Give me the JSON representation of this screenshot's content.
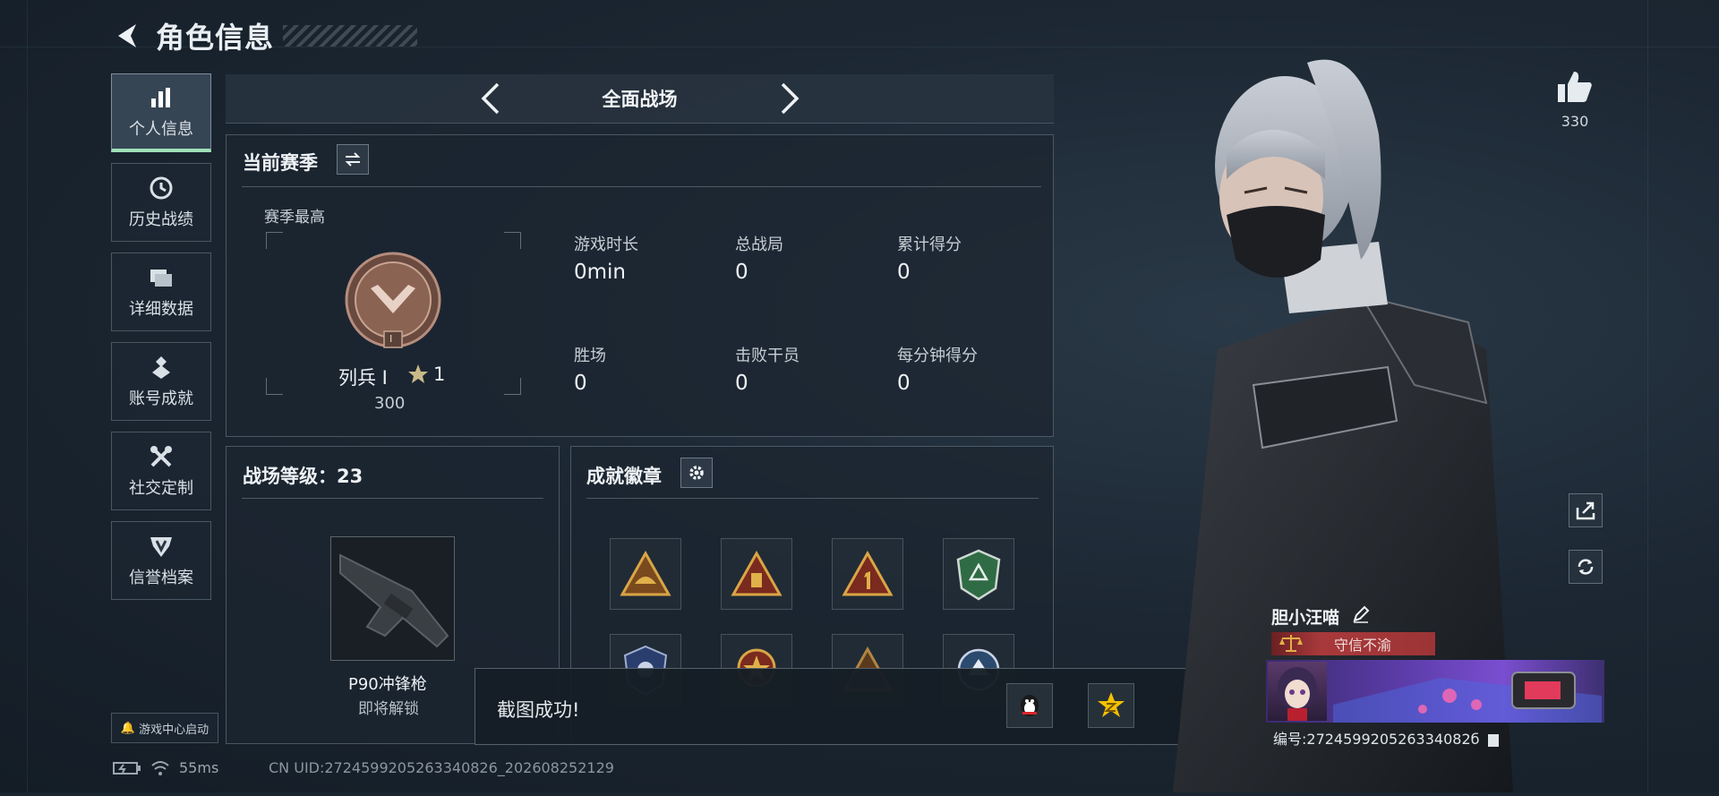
{
  "header": {
    "title": "角色信息"
  },
  "nav": {
    "items": [
      {
        "label": "个人信息"
      },
      {
        "label": "历史战绩"
      },
      {
        "label": "详细数据"
      },
      {
        "label": "账号成就"
      },
      {
        "label": "社交定制"
      },
      {
        "label": "信誉档案"
      }
    ],
    "launch_label": "游戏中心启动"
  },
  "mode": {
    "title": "全面战场"
  },
  "season": {
    "title": "当前赛季",
    "best_label": "赛季最高",
    "rank_name": "列兵 I",
    "stars": "1",
    "rank_score": "300",
    "rank_level": "I",
    "stats": [
      {
        "label": "游戏时长",
        "value": "0min"
      },
      {
        "label": "总战局",
        "value": "0"
      },
      {
        "label": "累计得分",
        "value": "0"
      },
      {
        "label": "胜场",
        "value": "0"
      },
      {
        "label": "击败干员",
        "value": "0"
      },
      {
        "label": "每分钟得分",
        "value": "0"
      }
    ]
  },
  "battlefield": {
    "level_title": "战场等级：23",
    "weapon_name": "P90冲锋枪",
    "weapon_status": "即将解锁"
  },
  "achievements": {
    "title": "成就徽章"
  },
  "toast": {
    "message": "截图成功!"
  },
  "right": {
    "likes": "330",
    "player_name": "胆小汪喵",
    "player_title": "守信不渝",
    "player_id": "编号:272459920526334082б"
  },
  "status_bar": {
    "ping": "55ms",
    "uid": "CN UID:2724599205263340826_202608252129"
  }
}
